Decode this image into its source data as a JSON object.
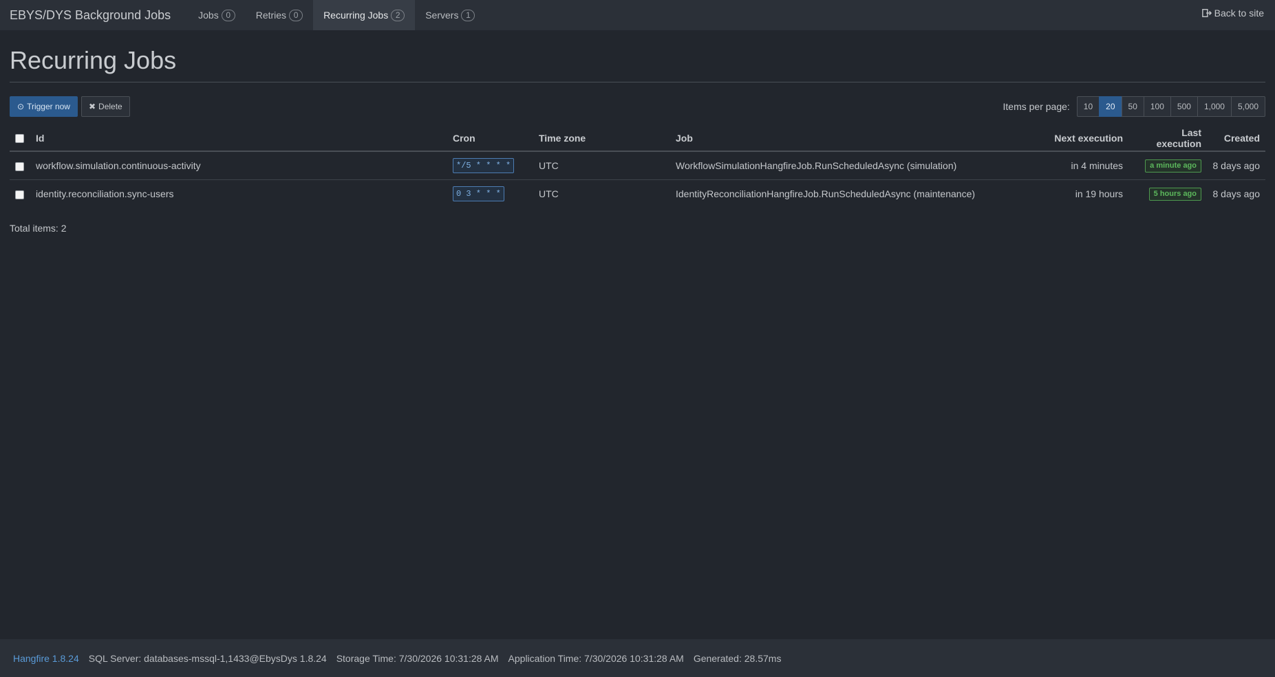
{
  "navbar": {
    "brand": "EBYS/DYS Background Jobs",
    "items": [
      {
        "label": "Jobs",
        "count": "0"
      },
      {
        "label": "Retries",
        "count": "0"
      },
      {
        "label": "Recurring Jobs",
        "count": "2"
      },
      {
        "label": "Servers",
        "count": "1"
      }
    ],
    "active_item": "Recurring Jobs",
    "back_label": "Back to site"
  },
  "page": {
    "title": "Recurring Jobs"
  },
  "toolbar": {
    "trigger_label": "Trigger now",
    "delete_label": "Delete",
    "items_per_page_label": "Items per page:",
    "page_sizes": [
      "10",
      "20",
      "50",
      "100",
      "500",
      "1,000",
      "5,000"
    ],
    "selected_page_size": "20"
  },
  "table": {
    "columns": [
      "Id",
      "Cron",
      "Time zone",
      "Job",
      "Next execution",
      "Last execution",
      "Created"
    ],
    "rows": [
      {
        "id": "workflow.simulation.continuous-activity",
        "cron": "*/5 * * * *",
        "timezone": "UTC",
        "job": "WorkflowSimulationHangfireJob.RunScheduledAsync (simulation)",
        "next_execution": "in 4 minutes",
        "last_execution": "a minute ago",
        "created": "8 days ago"
      },
      {
        "id": "identity.reconciliation.sync-users",
        "cron": "0 3 * * *",
        "timezone": "UTC",
        "job": "IdentityReconciliationHangfireJob.RunScheduledAsync (maintenance)",
        "next_execution": "in 19 hours",
        "last_execution": "5 hours ago",
        "created": "8 days ago"
      }
    ]
  },
  "total_items_text": "Total items: 2",
  "footer": {
    "version": "Hangfire 1.8.24",
    "storage": "SQL Server: databases-mssql-1,1433@EbysDys 1.8.24",
    "storage_time": "Storage Time: 7/30/2026 10:31:28 AM",
    "application_time": "Application Time: 7/30/2026 10:31:28 AM",
    "generated": "Generated: 28.57ms"
  },
  "colors": {
    "background": "#22262d",
    "navbar": "#2b3038",
    "primary": "#2b5a8e",
    "success": "#5cb85c",
    "link": "#5a9bd8"
  },
  "icons": {
    "trigger": "play-circle-icon",
    "delete": "close-icon",
    "back": "sign-out-icon"
  }
}
